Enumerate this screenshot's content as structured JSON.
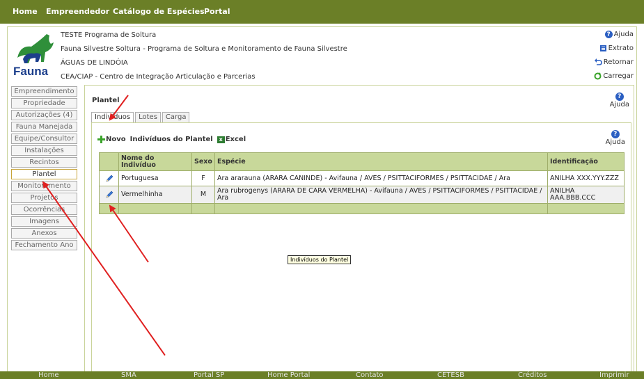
{
  "topnav": [
    "Home",
    "Empreendedor",
    "Catálogo de Espécies",
    "Portal"
  ],
  "header": {
    "logo_text": "Fauna",
    "line1": "TESTE Programa de Soltura",
    "line2": "Fauna Silvestre Soltura - Programa de Soltura e Monitoramento de Fauna Silvestre",
    "line3": "ÁGUAS DE LINDÓIA",
    "line4": "CEA/CIAP - Centro de Integração Articulação e Parcerias",
    "links": [
      "Ajuda",
      "Extrato",
      "Retornar",
      "Carregar"
    ]
  },
  "sidebar": {
    "items": [
      "Empreendimento",
      "Propriedade",
      "Autorizações (4)",
      "Fauna Manejada",
      "Equipe/Consultor",
      "Instalações",
      "Recintos",
      "Plantel",
      "Monitoramento",
      "Projetos",
      "Ocorrências",
      "Imagens",
      "Anexos",
      "Fechamento Ano"
    ],
    "active": "Plantel"
  },
  "content": {
    "title": "Plantel",
    "help": "Ajuda",
    "tabs": [
      "Indivíduos",
      "Lotes",
      "Carga"
    ],
    "active_tab": "Indivíduos",
    "toolbar": {
      "novo": "Novo",
      "title": "Indivíduos do Plantel",
      "excel": "Excel",
      "help": "Ajuda"
    },
    "table": {
      "headers": [
        "",
        "Nome do Indivíduo",
        "Sexo",
        "Espécie",
        "Identificação"
      ],
      "rows": [
        [
          "Portuguesa",
          "F",
          "Ara ararauna (ARARA CANINDE) - Avifauna / AVES / PSITTACIFORMES / PSITTACIDAE / Ara",
          "ANILHA XXX.YYY.ZZZ"
        ],
        [
          "Vermelhinha",
          "M",
          "Ara rubrogenys (ARARA DE CARA VERMELHA) - Avifauna / AVES / PSITTACIFORMES / PSITTACIDAE / Ara",
          "ANILHA AAA.BBB.CCC"
        ]
      ]
    },
    "tooltip": "Indivíduos do Plantel"
  },
  "footer": [
    "Home",
    "SMA",
    "Portal SP",
    "Home Portal",
    "Contato",
    "CETESB",
    "Créditos",
    "Imprimir"
  ],
  "colors": {
    "nav": "#6b7f27",
    "table_header": "#c8d89a",
    "annotation": "#e02020",
    "help_icon": "#2b5fc2"
  }
}
